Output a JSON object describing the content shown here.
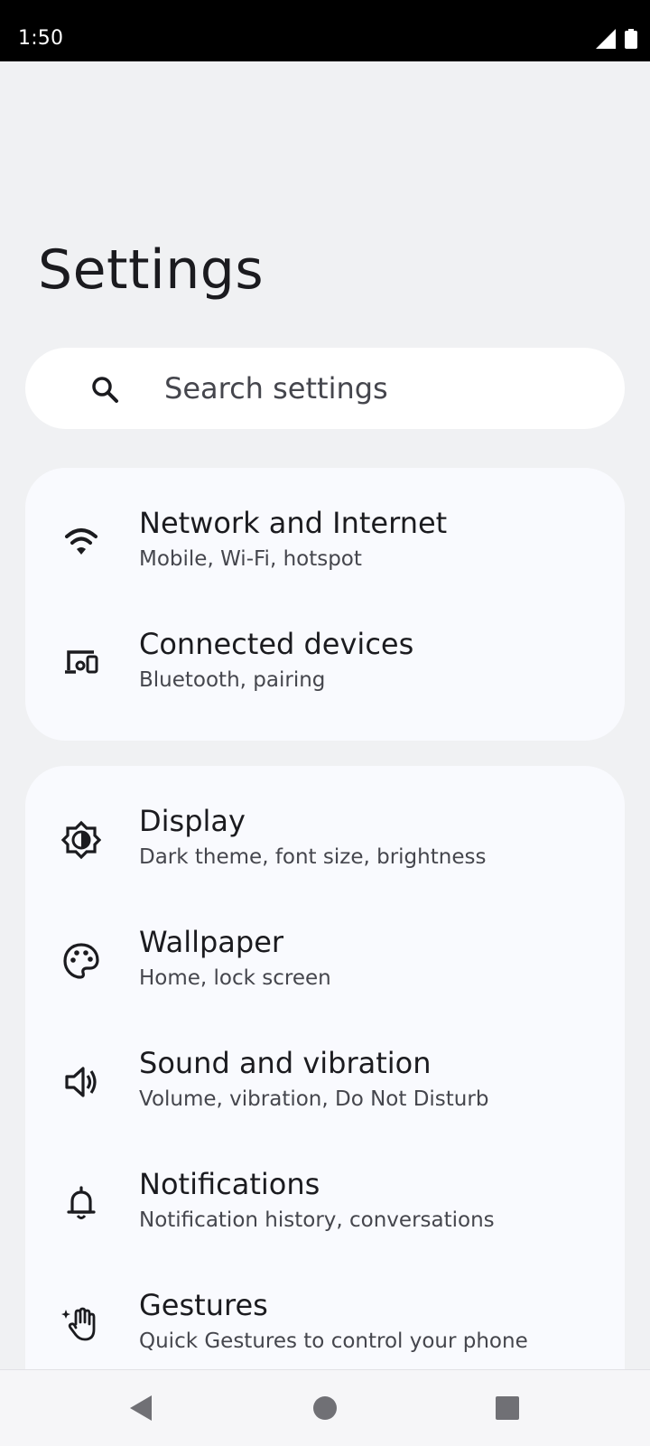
{
  "status_bar": {
    "time": "1:50",
    "icons": [
      "cellular-signal-icon",
      "battery-icon"
    ]
  },
  "page_title": "Settings",
  "search": {
    "placeholder": "Search settings",
    "icon": "search-icon"
  },
  "groups": [
    {
      "items": [
        {
          "title": "Network and Internet",
          "subtitle": "Mobile, Wi-Fi, hotspot",
          "icon": "wifi-icon"
        },
        {
          "title": "Connected devices",
          "subtitle": "Bluetooth, pairing",
          "icon": "connected-devices-icon"
        }
      ]
    },
    {
      "items": [
        {
          "title": "Display",
          "subtitle": "Dark theme, font size, brightness",
          "icon": "brightness-icon"
        },
        {
          "title": "Wallpaper",
          "subtitle": "Home, lock screen",
          "icon": "palette-icon"
        },
        {
          "title": "Sound and vibration",
          "subtitle": "Volume, vibration, Do Not Disturb",
          "icon": "volume-icon"
        },
        {
          "title": "Notifications",
          "subtitle": "Notification history, conversations",
          "icon": "bell-icon"
        },
        {
          "title": "Gestures",
          "subtitle": "Quick Gestures to control your phone",
          "icon": "gesture-hand-icon"
        }
      ]
    }
  ],
  "nav_bar": {
    "icons": [
      "back-icon",
      "home-icon",
      "recents-icon"
    ]
  },
  "colors": {
    "background": "#f0f1f3",
    "card": "#f9fafe",
    "search_bg": "#ffffff",
    "title_text": "#1b1b1f",
    "subtitle_text": "#45464d"
  }
}
